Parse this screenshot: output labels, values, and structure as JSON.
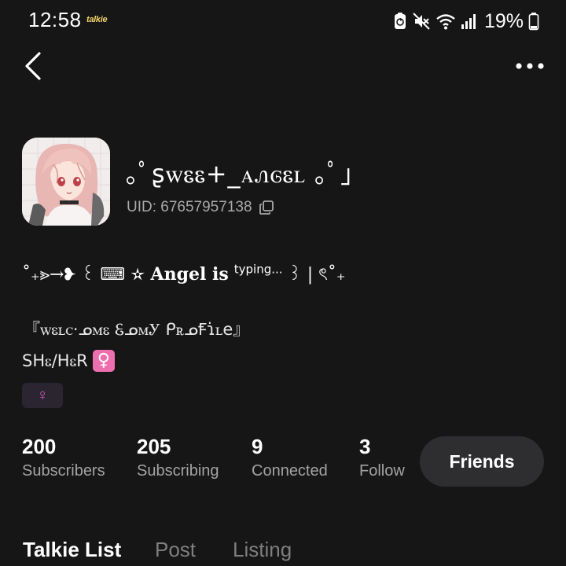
{
  "status_bar": {
    "time": "12:58",
    "app_badge": "talkie",
    "battery_percent": "19%"
  },
  "app_bar": {
    "back_icon": "chevron-left-icon",
    "more_icon": "more-horizontal-icon"
  },
  "profile": {
    "display_name": "｡ﾟʂꮃꮛꮛ+_ꭺꮑꮆꮛꮮ ｡ﾟ」",
    "uid": "UID: 67657957138",
    "bio": {
      "line1_prefix": "˚₊⪢→❥ ꒰ ⌨ ✫ ",
      "line1_bold": "Angel is",
      "line1_sup": "typing...",
      "line1_suffix": " ꒱ | ৎ˚₊",
      "line2": "『ꮃꮛꮮꮯ⋅ᓄꮇꮛ ᏋᓄꮇᎩ ᑭꭱᓄꞘɿ̇ꮮe』",
      "line3_text": "SHꮛ/HꮛR",
      "line3_emoji": "♀"
    },
    "gender_tag": "♀"
  },
  "stats": [
    {
      "value": "200",
      "label": "Subscribers"
    },
    {
      "value": "205",
      "label": "Subscribing"
    },
    {
      "value": "9",
      "label": "Connected"
    },
    {
      "value": "3",
      "label": "Follow"
    }
  ],
  "friends_button": "Friends",
  "tabs": [
    {
      "label": "Talkie List",
      "active": true
    },
    {
      "label": "Post",
      "active": false
    },
    {
      "label": "Listing",
      "active": false
    }
  ],
  "colors": {
    "background": "#161616",
    "secondary_text": "#a3a3a3",
    "friends_button_bg": "#2e2e30",
    "gender_pink": "#d65cc1",
    "emoji_pink": "#ee6fae"
  }
}
